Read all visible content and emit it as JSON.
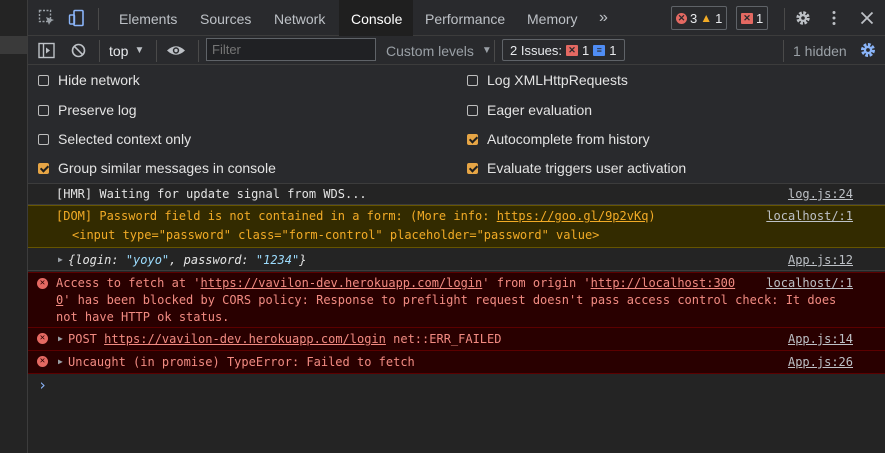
{
  "tabs": [
    {
      "label": "Elements",
      "active": false
    },
    {
      "label": "Sources",
      "active": false
    },
    {
      "label": "Network",
      "active": false
    },
    {
      "label": "Console",
      "active": true
    },
    {
      "label": "Performance",
      "active": false
    },
    {
      "label": "Memory",
      "active": false
    }
  ],
  "tab_overflow": "»",
  "counts": {
    "errors": "3",
    "warnings": "1",
    "issues": "1"
  },
  "toolbar": {
    "context": "top",
    "filter_placeholder": "Filter",
    "levels": "Custom levels",
    "issues_label": "2 Issues:",
    "issues_errors": "1",
    "issues_info": "1",
    "hidden": "1 hidden"
  },
  "settings": {
    "left": [
      {
        "label": "Hide network",
        "checked": false
      },
      {
        "label": "Preserve log",
        "checked": false
      },
      {
        "label": "Selected context only",
        "checked": false
      },
      {
        "label": "Group similar messages in console",
        "checked": true
      }
    ],
    "right": [
      {
        "label": "Log XMLHttpRequests",
        "checked": false
      },
      {
        "label": "Eager evaluation",
        "checked": false
      },
      {
        "label": "Autocomplete from history",
        "checked": true
      },
      {
        "label": "Evaluate triggers user activation",
        "checked": true
      }
    ]
  },
  "console": {
    "msg1": {
      "text": "[HMR] Waiting for update signal from WDS...",
      "source": "log.js:24"
    },
    "msg2": {
      "text_a": "[DOM] Password field is not contained in a form: (More info: ",
      "link": "https://goo.gl/9p2vKq",
      "text_b": ")",
      "line2": "<input type=\"password\" class=\"form-control\" placeholder=\"password\" value>",
      "source": "localhost/:1"
    },
    "msg3": {
      "open": "{",
      "k1": "login",
      "v1": "\"yoyo\"",
      "sep": ", ",
      "k2": "password",
      "v2": "\"1234\"",
      "close": "}",
      "source": "App.js:12"
    },
    "msg4": {
      "a": "Access to fetch at '",
      "url": "https://vavilon-dev.herokuapp.com/login",
      "b": "' from origin '",
      "origin": "http://localhost:300",
      "line2_origin_tail": "0",
      "line2_rest": "' has been blocked by CORS policy: Response to preflight request doesn't pass access control check: It does",
      "line3": "not have HTTP ok status.",
      "source": "localhost/:1"
    },
    "msg5": {
      "method": "POST ",
      "url": "https://vavilon-dev.herokuapp.com/login",
      "rest": " net::ERR_FAILED",
      "source": "App.js:14"
    },
    "msg6": {
      "text": "Uncaught (in promise) TypeError: Failed to fetch",
      "source": "App.js:26"
    },
    "prompt": "›"
  }
}
